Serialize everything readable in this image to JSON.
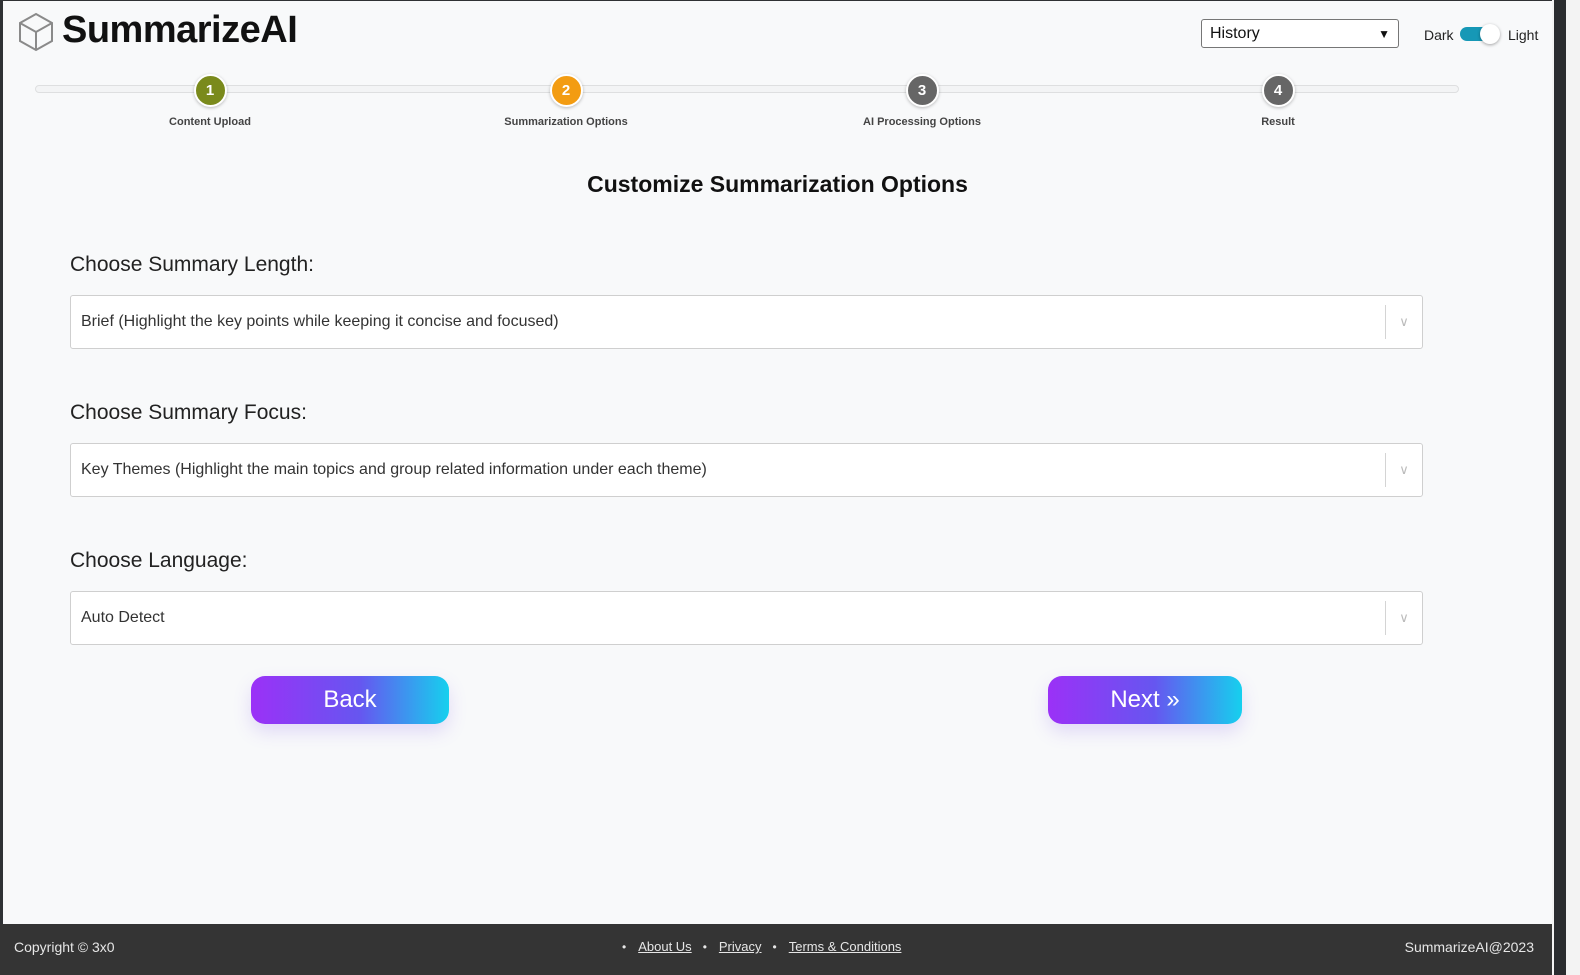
{
  "app": {
    "name": "SummarizeAI"
  },
  "header": {
    "history_select": {
      "value": "History"
    },
    "theme": {
      "dark_label": "Dark",
      "light_label": "Light",
      "toggle_accent": "#1698b6"
    }
  },
  "stepper": {
    "steps": [
      {
        "number": "1",
        "label": "Content Upload",
        "color": "#7a8a1c",
        "state": "completed"
      },
      {
        "number": "2",
        "label": "Summarization Options",
        "color": "#f39c12",
        "state": "active"
      },
      {
        "number": "3",
        "label": "AI Processing Options",
        "color": "#666666",
        "state": "pending"
      },
      {
        "number": "4",
        "label": "Result",
        "color": "#666666",
        "state": "pending"
      }
    ]
  },
  "main": {
    "title": "Customize Summarization Options",
    "fields": [
      {
        "label": "Choose Summary Length:",
        "value": "Brief (Highlight the key points while keeping it concise and focused)"
      },
      {
        "label": "Choose Summary Focus:",
        "value": "Key Themes (Highlight the main topics and group related information under each theme)"
      },
      {
        "label": "Choose Language:",
        "value": "Auto Detect"
      }
    ],
    "back_label": "Back",
    "next_label": "Next »",
    "button_gradient": [
      "#9b31f7",
      "#16d0ee"
    ]
  },
  "footer": {
    "copyright": "Copyright © 3x0",
    "links": [
      "About Us",
      "Privacy",
      "Terms & Conditions"
    ],
    "brand": "SummarizeAI@2023"
  }
}
